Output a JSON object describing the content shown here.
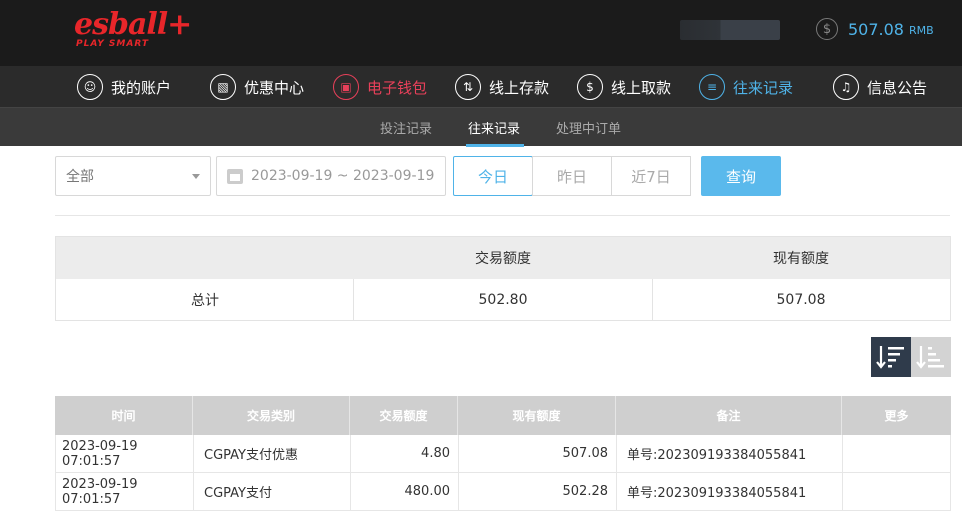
{
  "header": {
    "logo_main": "esball+",
    "logo_sub": "PLAY SMART",
    "balance_icon": "dollar-coin-icon",
    "balance_amount": "507.08",
    "balance_unit": "RMB"
  },
  "nav": {
    "items": [
      {
        "label": "我的账户",
        "icon": "user-icon"
      },
      {
        "label": "优惠中心",
        "icon": "gift-icon"
      },
      {
        "label": "电子钱包",
        "icon": "wallet-icon"
      },
      {
        "label": "线上存款",
        "icon": "deposit-icon"
      },
      {
        "label": "线上取款",
        "icon": "withdraw-icon"
      },
      {
        "label": "往来记录",
        "icon": "records-icon"
      },
      {
        "label": "信息公告",
        "icon": "bell-icon"
      }
    ]
  },
  "subnav": {
    "items": [
      "投注记录",
      "往来记录",
      "处理中订单"
    ],
    "active": "往来记录"
  },
  "filter": {
    "type_value": "全部",
    "date_range": "2023-09-19 ~ 2023-09-19",
    "ranges": [
      "今日",
      "昨日",
      "近7日"
    ],
    "active_range": "今日",
    "query_label": "查询"
  },
  "summary": {
    "headers": [
      "",
      "交易额度",
      "现有额度"
    ],
    "row_label": "总计",
    "transaction_total": "502.80",
    "current_total": "507.08"
  },
  "sort": {
    "desc_icon": "sort-desc-icon",
    "asc_icon": "sort-asc-icon"
  },
  "records": {
    "columns": [
      "时间",
      "交易类别",
      "交易额度",
      "现有额度",
      "备注",
      "更多"
    ],
    "rows": [
      {
        "time": "2023-09-19 07:01:57",
        "category": "CGPAY支付优惠",
        "amount": "4.80",
        "balance": "507.08",
        "note": "单号:202309193384055841",
        "more": ""
      },
      {
        "time": "2023-09-19 07:01:57",
        "category": "CGPAY支付",
        "amount": "480.00",
        "balance": "502.28",
        "note": "单号:202309193384055841",
        "more": ""
      }
    ]
  },
  "colors": {
    "accent_blue": "#4fb3e8",
    "brand_red": "#e8262a",
    "nav_active_red": "#e8405a"
  }
}
